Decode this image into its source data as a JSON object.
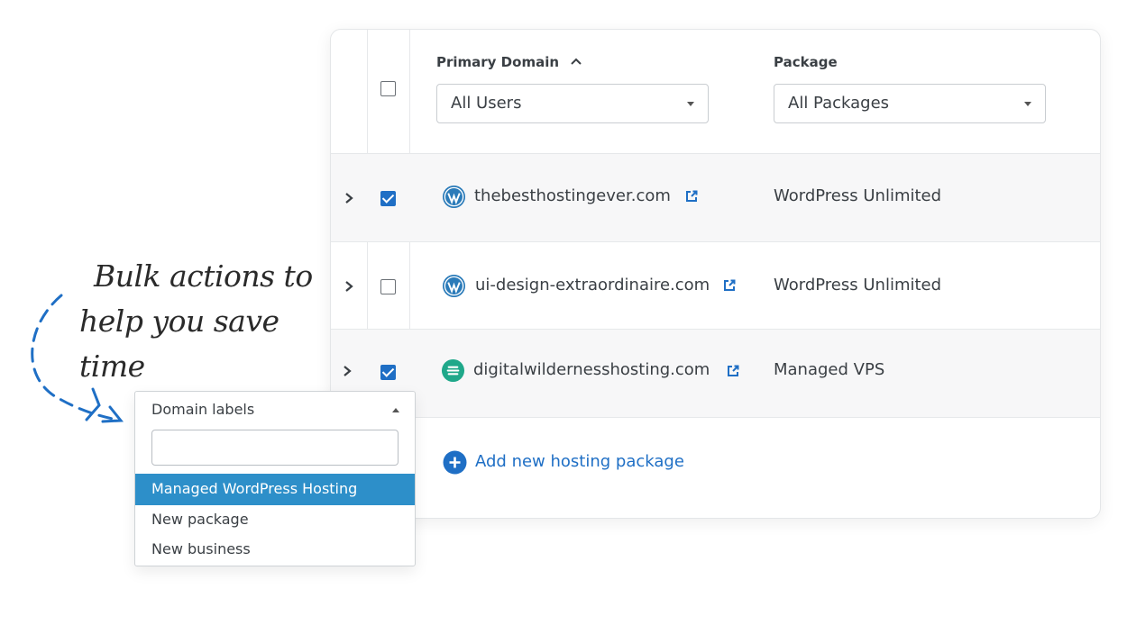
{
  "annotation": {
    "line1": "Bulk actions to",
    "line2": "help you save time"
  },
  "table": {
    "columns": {
      "domain": "Primary Domain",
      "package": "Package"
    },
    "filters": {
      "users": "All Users",
      "packages": "All Packages"
    },
    "rows": [
      {
        "domain": "thebesthostingever.com",
        "package": "WordPress Unlimited",
        "checked": true,
        "icon": "wordpress-icon"
      },
      {
        "domain": "ui-design-extraordinaire.com",
        "package": "WordPress Unlimited",
        "checked": false,
        "icon": "wordpress-icon"
      },
      {
        "domain": "digitalwildernesshosting.com",
        "package": "Managed VPS",
        "checked": true,
        "icon": "hosting-logo-icon"
      }
    ],
    "add_link": "Add new hosting package"
  },
  "dropdown": {
    "header": "Domain labels",
    "search_value": "",
    "options": [
      "Managed WordPress Hosting",
      "New package",
      "New business"
    ],
    "active_index": 0
  },
  "colors": {
    "accent": "#1f6fc5",
    "highlight": "#2d8fc9",
    "wordpress": "#2b7bb9",
    "hosting_logo": "#1fa88a"
  }
}
